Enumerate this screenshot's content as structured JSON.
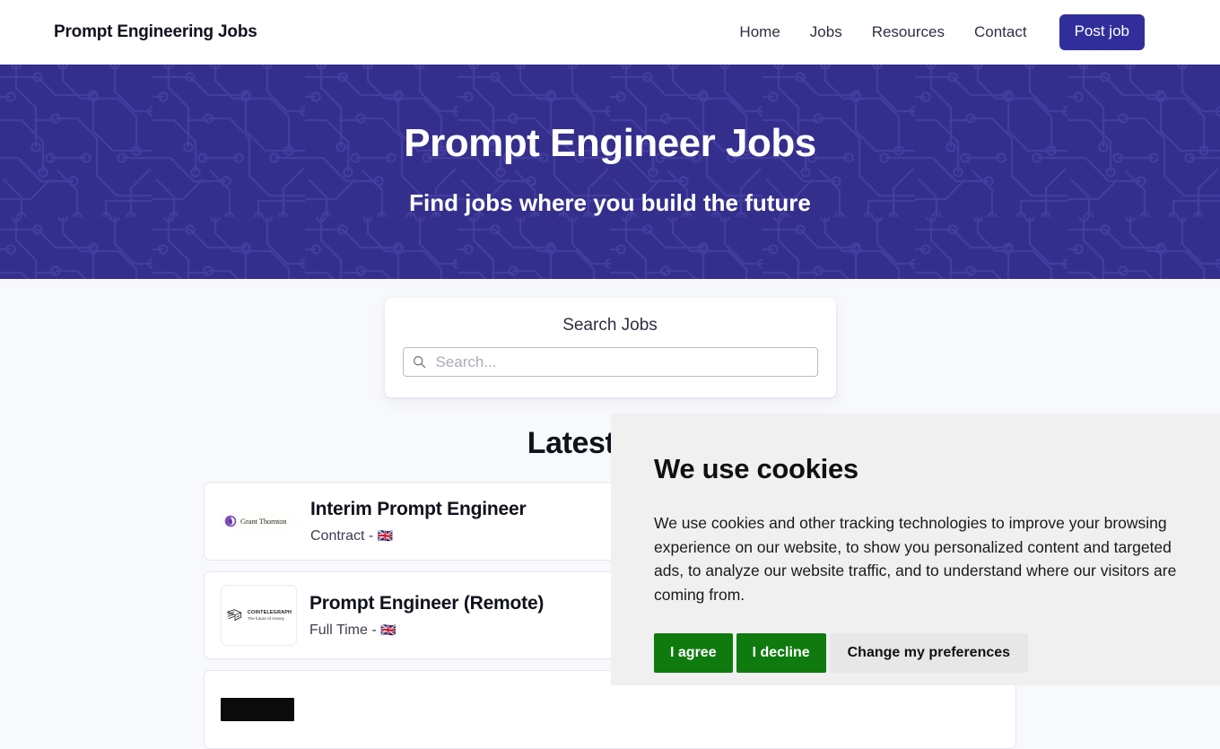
{
  "header": {
    "brand": "Prompt Engineering Jobs",
    "nav": [
      {
        "label": "Home"
      },
      {
        "label": "Jobs"
      },
      {
        "label": "Resources"
      },
      {
        "label": "Contact"
      }
    ],
    "post_job_label": "Post job",
    "accent_color": "#312e9b"
  },
  "hero": {
    "title": "Prompt Engineer Jobs",
    "subtitle": "Find jobs where you build the future",
    "background_color": "#342f8c",
    "pattern": "circuit-board-pattern",
    "pattern_line_color": "#433da0"
  },
  "search": {
    "label": "Search Jobs",
    "placeholder": "Search...",
    "value": "",
    "icon": "search-icon"
  },
  "latest": {
    "heading": "Latest Jobs",
    "jobs": [
      {
        "title": "Interim Prompt Engineer",
        "type": "Contract",
        "separator": "-",
        "flag": "🇬🇧",
        "company": "Grant Thornton",
        "logo": "grant-thornton-logo",
        "logo_mark_color": "#7b4fb5"
      },
      {
        "title": "Prompt Engineer (Remote)",
        "type": "Full Time",
        "separator": "-",
        "flag": "🇬🇧",
        "company": "COINTELEGRAPH",
        "company_tagline": "The future of money",
        "logo": "cointelegraph-logo"
      },
      {
        "title": "",
        "type": "",
        "separator": "",
        "flag": "",
        "company": "",
        "logo": "dark-company-logo"
      }
    ]
  },
  "cookie_banner": {
    "title": "We use cookies",
    "body": "We use cookies and other tracking technologies to improve your browsing experience on our website, to show you personalized content and targeted ads, to analyze our website traffic, and to understand where our visitors are coming from.",
    "agree_label": "I agree",
    "decline_label": "I decline",
    "preferences_label": "Change my preferences",
    "accept_color": "#0f7b0f",
    "background_color": "#f0f0f0"
  }
}
